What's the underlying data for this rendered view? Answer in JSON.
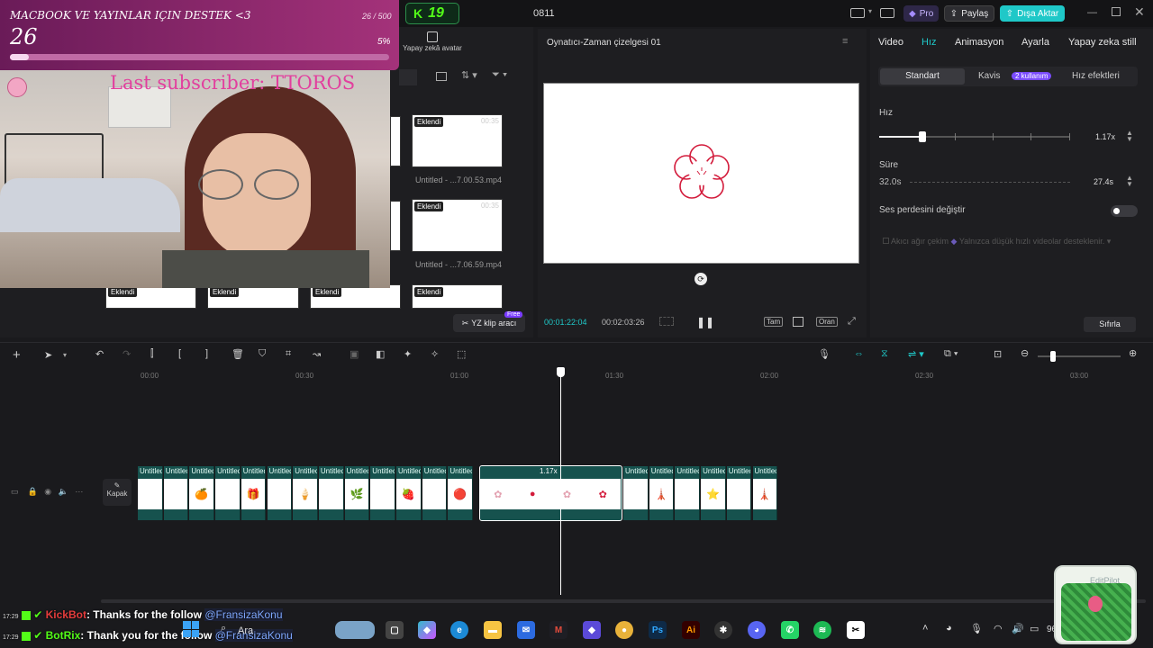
{
  "topbar": {
    "title": "0811",
    "stream_counter": "19",
    "pro_label": "Pro",
    "share_label": "Paylaş",
    "export_label": "Dışa Aktar",
    "accent": "#1fc8c8"
  },
  "sub_goal": {
    "title": "MACBOOK VE YAYINLAR IÇIN DESTEK <3",
    "current": "26",
    "progress_text": "26 / 500",
    "percent_text": "5%",
    "progress": 0.05
  },
  "last_sub": "Last subscriber: TTOROS",
  "media": {
    "ai_avatar_label": "Yapay zekâ avatar",
    "yz_tool_label": "YZ klip aracı",
    "free_badge": "Free",
    "thumbs": [
      {
        "badge": "Eklendi",
        "dur": "00:35",
        "caption": "Untitled - ...7.00.53.mp4"
      },
      {
        "badge": "Eklendi",
        "dur": "00:35",
        "caption": "Untitled - ...7.06.59.mp4"
      }
    ],
    "bottom_badges": [
      "Eklendi",
      "Eklendi",
      "Eklendi",
      "Eklendi"
    ]
  },
  "player": {
    "title": "Oynatıcı-Zaman çizelgesi 01",
    "current_time": "00:01:22:04",
    "total_time": "00:02:03:26",
    "full_label": "Tam",
    "ratio_label": "Oran"
  },
  "inspector": {
    "tabs": [
      "Video",
      "Hız",
      "Animasyon",
      "Ayarla",
      "Yapay zeka still"
    ],
    "subtabs": [
      "Standart",
      "Kavis",
      "Hız efektleri"
    ],
    "subtab_badge": "2 kullanım",
    "speed_label": "Hız",
    "speed_value": "1.17x",
    "duration_label": "Süre",
    "duration_from": "32.0s",
    "duration_value": "27.4s",
    "pitch_label": "Ses perdesini değiştir",
    "smooth_label": "Akıcı ağır çekim",
    "smooth_note": "Yalnızca düşük hızlı videolar desteklenir.",
    "reset_label": "Sıfırla"
  },
  "timeline": {
    "ticks": [
      "00:00",
      "00:30",
      "01:00",
      "01:30",
      "02:00",
      "02:30",
      "03:00"
    ],
    "cover_label": "Kapak",
    "clip_label": "Untitled",
    "selected_speed": "1.17x",
    "clips_before": 13,
    "clips_after": 6
  },
  "chat": [
    {
      "time": "17:29",
      "user": "KickBot",
      "text": ": Thanks for the follow ",
      "mention": "@FransizaKonu"
    },
    {
      "time": "17:29",
      "user": "BotRix",
      "text": ": Thank you for the follow ",
      "mention": "@FransizaKonu"
    }
  ],
  "taskbar": {
    "search": "Ara",
    "pilot": "EditPilot",
    "battery": "96"
  }
}
